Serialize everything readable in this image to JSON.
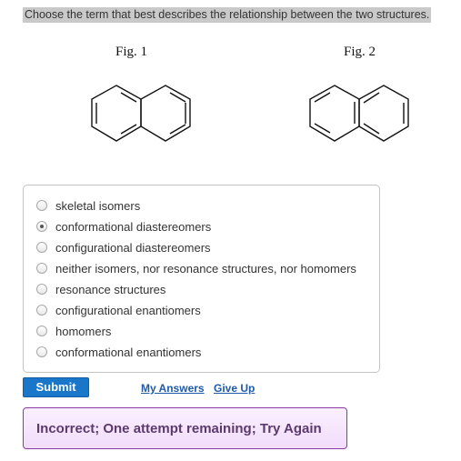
{
  "question": {
    "prompt": "Choose the term that best describes the relationship between the two structures."
  },
  "figures": [
    {
      "label": "Fig. 1",
      "molecule": "naphthalene"
    },
    {
      "label": "Fig. 2",
      "molecule": "naphthalene"
    }
  ],
  "options": [
    {
      "label": "skeletal isomers",
      "selected": false
    },
    {
      "label": "conformational diastereomers",
      "selected": true
    },
    {
      "label": "configurational diastereomers",
      "selected": false
    },
    {
      "label": "neither isomers, nor resonance structures, nor homomers",
      "selected": false
    },
    {
      "label": "resonance structures",
      "selected": false
    },
    {
      "label": "configurational enantiomers",
      "selected": false
    },
    {
      "label": "homomers",
      "selected": false
    },
    {
      "label": "conformational enantiomers",
      "selected": false
    }
  ],
  "actions": {
    "submit_label": "Submit",
    "my_answers_label": "My Answers",
    "give_up_label": "Give Up"
  },
  "feedback": {
    "text": "Incorrect; One attempt remaining; Try Again"
  },
  "colors": {
    "submit_bg": "#1a76c8",
    "feedback_border": "#8c3aa3",
    "link": "#1f5ba8"
  }
}
